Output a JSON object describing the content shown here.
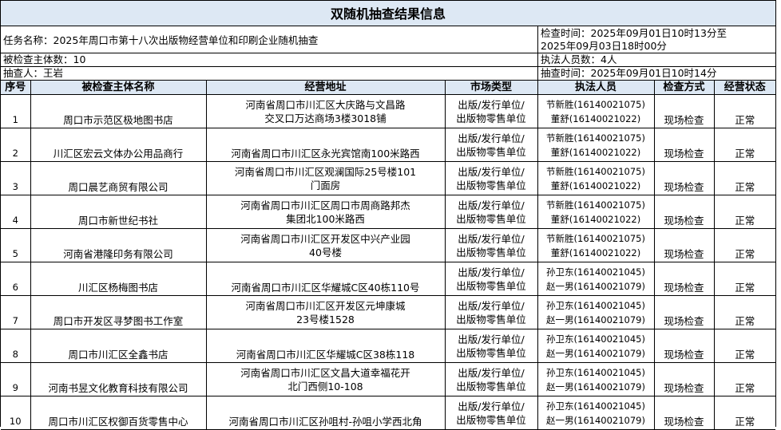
{
  "title": "双随机抽查结果信息",
  "task": {
    "name_label": "任务名称：",
    "name": "2025年周口市第十八次出版物经营单位和印刷企业随机抽查",
    "time_label": "检查时间：",
    "time_line1": "2025年09月01日10时13分至",
    "time_line2": "2025年09月03日18时00分",
    "subject_count_label": "被检查主体数：",
    "subject_count": "10",
    "officer_count_label": "执法人员数：",
    "officer_count": "4人",
    "inspector_label": "抽查人：",
    "inspector": "王岩",
    "check_time_label": "抽查时间：",
    "check_time": "2025年09月01日10时14分"
  },
  "table": {
    "headers": [
      "序号",
      "被检查主体名称",
      "经营地址",
      "市场类型",
      "执法人员",
      "检查方式",
      "经营状态"
    ],
    "rows": [
      {
        "no": "1",
        "name": "周口市示范区极地图书店",
        "addr1": "河南省周口市川汇区大庆路与文昌路",
        "addr2": "交叉口万达商场3楼3018铺",
        "type1": "出版/发行单位/",
        "type2": "出版物零售单位",
        "off1": "节新胜(16140021075)",
        "off2": "董舒(16140021022)",
        "method": "现场检查",
        "status": "正常"
      },
      {
        "no": "2",
        "name": "川汇区宏云文体办公用品商行",
        "addr1": "河南省周口市川汇区永光宾馆南100米路西",
        "addr2": "",
        "type1": "出版/发行单位/",
        "type2": "出版物零售单位",
        "off1": "节新胜(16140021075)",
        "off2": "董舒(16140021022)",
        "method": "现场检查",
        "status": "正常"
      },
      {
        "no": "3",
        "name": "周口晨艺商贸有限公司",
        "addr1": "河南省周口市川汇区观澜国际25号楼101",
        "addr2": "门面房",
        "type1": "出版/发行单位/",
        "type2": "出版物零售单位",
        "off1": "节新胜(16140021075)",
        "off2": "董舒(16140021022)",
        "method": "现场检查",
        "status": "正常"
      },
      {
        "no": "4",
        "name": "周口市新世纪书社",
        "addr1": "河南省周口市川汇区周口市周商路邦杰",
        "addr2": "集团北100米路西",
        "type1": "出版/发行单位/",
        "type2": "出版物零售单位",
        "off1": "节新胜(16140021075)",
        "off2": "董舒(16140021022)",
        "method": "现场检查",
        "status": "正常"
      },
      {
        "no": "5",
        "name": "河南省港隆印务有限公司",
        "addr1": "河南省周口市川汇区开发区中兴产业园",
        "addr2": "40号楼",
        "type1": "出版/发行单位/",
        "type2": "出版物零售单位",
        "off1": "节新胜(16140021075)",
        "off2": "董舒(16140021022)",
        "method": "现场检查",
        "status": "正常"
      },
      {
        "no": "6",
        "name": "川汇区杨梅图书店",
        "addr1": "河南省周口市川汇区华耀城C区40栋110号",
        "addr2": "",
        "type1": "出版/发行单位/",
        "type2": "出版物零售单位",
        "off1": "孙卫东(16140021045)",
        "off2": "赵一男(16140021079)",
        "method": "现场检查",
        "status": "正常"
      },
      {
        "no": "7",
        "name": "周口市开发区寻梦图书工作室",
        "addr1": "河南省周口市川汇区开发区元坤康城",
        "addr2": "23号楼1528",
        "type1": "出版/发行单位/",
        "type2": "出版物零售单位",
        "off1": "孙卫东(16140021045)",
        "off2": "赵一男(16140021079)",
        "method": "现场检查",
        "status": "正常"
      },
      {
        "no": "8",
        "name": "周口市川汇区全鑫书店",
        "addr1": "河南省周口市川汇区华耀城C区38栋118",
        "addr2": "",
        "type1": "出版/发行单位/",
        "type2": "出版物零售单位",
        "off1": "孙卫东(16140021045)",
        "off2": "赵一男(16140021079)",
        "method": "现场检查",
        "status": "正常"
      },
      {
        "no": "9",
        "name": "河南书昱文化教育科技有限公司",
        "addr1": "河南省周口市川汇区文昌大道幸福花开",
        "addr2": "北门西侧10-108",
        "type1": "出版/发行单位/",
        "type2": "出版物零售单位",
        "off1": "孙卫东(16140021045)",
        "off2": "赵一男(16140021079)",
        "method": "现场检查",
        "status": "正常"
      },
      {
        "no": "10",
        "name": "周口市川汇区权御百货零售中心",
        "addr1": "河南省周口市川汇区孙咀村-孙咀小学西北角",
        "addr2": "",
        "type1": "出版/发行单位/",
        "type2": "出版物零售单位",
        "off1": "孙卫东(16140021045)",
        "off2": "赵一男(16140021079)",
        "method": "现场检查",
        "status": "正常"
      }
    ]
  }
}
